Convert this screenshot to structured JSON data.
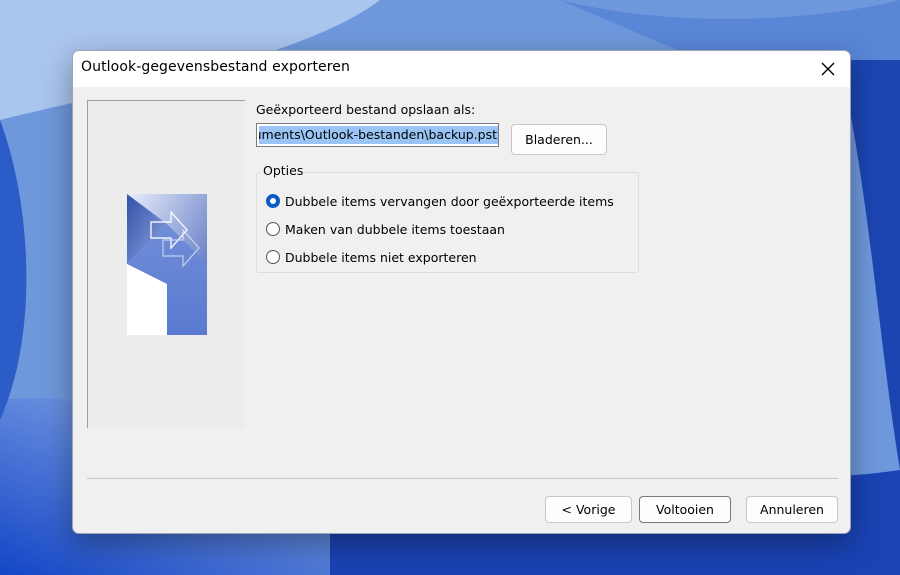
{
  "window": {
    "title": "Outlook-gegevensbestand exporteren"
  },
  "save_as": {
    "label": "Geëxporteerd bestand opslaan als:",
    "value": "ocuments\\Outlook-bestanden\\backup.pst",
    "browse_label": "Bladeren..."
  },
  "options": {
    "legend": "Opties",
    "items": [
      {
        "label": "Dubbele items vervangen door geëxporteerde items",
        "selected": true
      },
      {
        "label": "Maken van dubbele items toestaan",
        "selected": false
      },
      {
        "label": "Dubbele items niet exporteren",
        "selected": false
      }
    ]
  },
  "footer": {
    "prev_label": "< Vorige",
    "finish_label": "Voltooien",
    "cancel_label": "Annuleren"
  },
  "colors": {
    "accent": "#0a5bc7",
    "selection": "#99c4f5",
    "wallpaper": "#2a5bc4"
  }
}
